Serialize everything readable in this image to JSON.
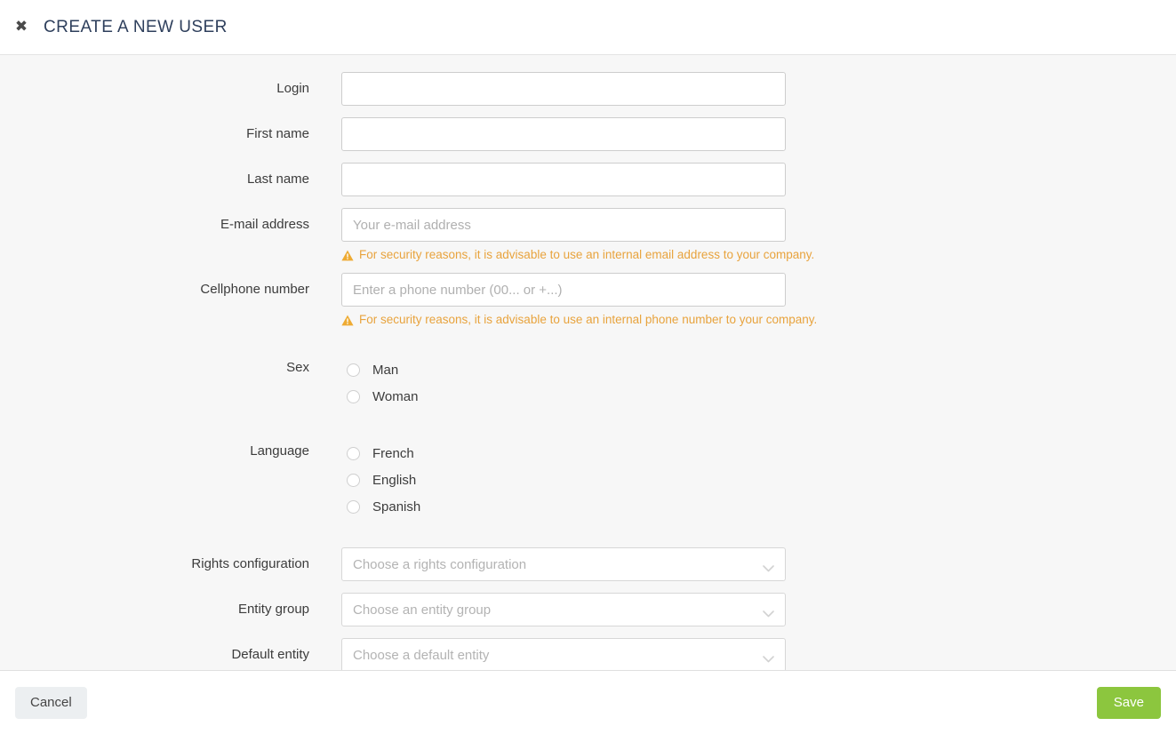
{
  "header": {
    "close_icon": "close-icon",
    "title": "CREATE A NEW USER"
  },
  "form": {
    "fields": [
      {
        "label": "Login",
        "placeholder": "",
        "value": "",
        "type": "text"
      },
      {
        "label": "First name",
        "placeholder": "",
        "value": "",
        "type": "text"
      },
      {
        "label": "Last name",
        "placeholder": "",
        "value": "",
        "type": "text"
      },
      {
        "label": "E-mail address",
        "placeholder": "Your e-mail address",
        "value": "",
        "type": "text",
        "hint": "For security reasons, it is advisable to use an internal email address to your company."
      },
      {
        "label": "Cellphone number",
        "placeholder": "Enter a phone number (00... or +...)",
        "value": "",
        "type": "text",
        "hint": "For security reasons, it is advisable to use an internal phone number to your company."
      }
    ],
    "sex": {
      "label": "Sex",
      "options": [
        "Man",
        "Woman"
      ],
      "selected": ""
    },
    "language": {
      "label": "Language",
      "options": [
        "French",
        "English",
        "Spanish"
      ],
      "selected": ""
    },
    "selects": [
      {
        "label": "Rights configuration",
        "placeholder": "Choose a rights configuration",
        "value": ""
      },
      {
        "label": "Entity group",
        "placeholder": "Choose an entity group",
        "value": ""
      },
      {
        "label": "Default entity",
        "placeholder": "Choose a default entity",
        "value": ""
      }
    ]
  },
  "footer": {
    "cancel_label": "Cancel",
    "save_label": "Save"
  },
  "colors": {
    "accent_green": "#8cc63e",
    "title_navy": "#2e3f5c",
    "warning_amber": "#e8a33d",
    "body_bg": "#f7f7f7",
    "cancel_bg": "#eceff1"
  }
}
